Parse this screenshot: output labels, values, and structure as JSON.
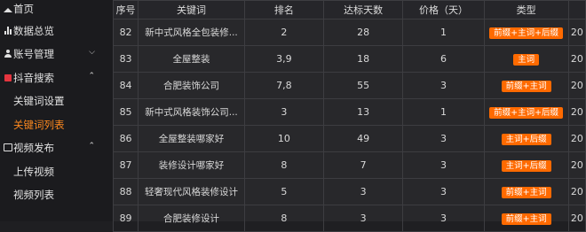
{
  "sidebar": {
    "items": [
      {
        "label": "首页",
        "icon": "home-icon"
      },
      {
        "label": "数据总览",
        "icon": "bar-chart-icon"
      },
      {
        "label": "账号管理",
        "icon": "user-icon",
        "chevron": "chevron-down-icon"
      },
      {
        "label": "抖音搜索",
        "icon": "douyin-icon",
        "chevron": "chevron-up-icon"
      },
      {
        "label": "关键词设置"
      },
      {
        "label": "关键词列表",
        "active": true
      },
      {
        "label": "视频发布",
        "icon": "video-icon",
        "chevron": "chevron-up-icon"
      },
      {
        "label": "上传视频"
      },
      {
        "label": "视频列表"
      }
    ],
    "active_color": "#ff8a1f"
  },
  "table": {
    "headers": [
      "序号",
      "关键词",
      "排名",
      "达标天数",
      "价格（天）",
      "类型",
      ""
    ],
    "rows": [
      {
        "id": "82",
        "keyword": "新中式风格全包装修...",
        "rank": "2",
        "days": "28",
        "price": "1",
        "type": "前缀+主词+后缀",
        "extra": "20"
      },
      {
        "id": "83",
        "keyword": "全屋整装",
        "rank": "3,9",
        "days": "18",
        "price": "6",
        "type": "主词",
        "extra": "20"
      },
      {
        "id": "84",
        "keyword": "合肥装饰公司",
        "rank": "7,8",
        "days": "55",
        "price": "3",
        "type": "前缀+主词",
        "extra": "20"
      },
      {
        "id": "85",
        "keyword": "新中式风格装饰公司...",
        "rank": "3",
        "days": "13",
        "price": "1",
        "type": "前缀+主词+后缀",
        "extra": "20"
      },
      {
        "id": "86",
        "keyword": "全屋整装哪家好",
        "rank": "10",
        "days": "49",
        "price": "3",
        "type": "主词+后缀",
        "extra": "20"
      },
      {
        "id": "87",
        "keyword": "装修设计哪家好",
        "rank": "8",
        "days": "7",
        "price": "3",
        "type": "主词+后缀",
        "extra": "20"
      },
      {
        "id": "88",
        "keyword": "轻奢现代风格装修设计",
        "rank": "5",
        "days": "3",
        "price": "3",
        "type": "前缀+主词",
        "extra": "20"
      },
      {
        "id": "89",
        "keyword": "合肥装修设计",
        "rank": "8",
        "days": "3",
        "price": "3",
        "type": "前缀+主词",
        "extra": "20"
      }
    ],
    "tag_color": "#ff6a00"
  }
}
